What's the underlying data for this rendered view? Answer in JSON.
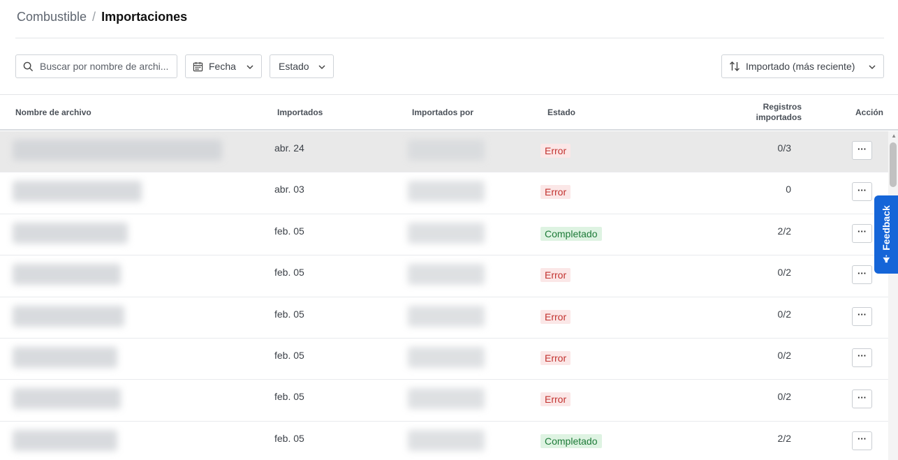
{
  "breadcrumb": {
    "parent": "Combustible",
    "separator": "/",
    "current": "Importaciones"
  },
  "toolbar": {
    "search_placeholder": "Buscar por nombre de archi...",
    "date_filter_label": "Fecha",
    "status_filter_label": "Estado",
    "sort_label": "Importado (más reciente)"
  },
  "table": {
    "headers": {
      "name": "Nombre de archivo",
      "imported": "Importados",
      "imported_by": "Importados por",
      "status": "Estado",
      "records_line1": "Registros",
      "records_line2": "importados",
      "action": "Acción"
    },
    "action_label": "···",
    "rows": [
      {
        "date": "abr. 24",
        "status": "Error",
        "records": "0/3",
        "status_kind": "error",
        "selected": true
      },
      {
        "date": "abr. 03",
        "status": "Error",
        "records": "0",
        "status_kind": "error"
      },
      {
        "date": "feb. 05",
        "status": "Completado",
        "records": "2/2",
        "status_kind": "done"
      },
      {
        "date": "feb. 05",
        "status": "Error",
        "records": "0/2",
        "status_kind": "error"
      },
      {
        "date": "feb. 05",
        "status": "Error",
        "records": "0/2",
        "status_kind": "error"
      },
      {
        "date": "feb. 05",
        "status": "Error",
        "records": "0/2",
        "status_kind": "error"
      },
      {
        "date": "feb. 05",
        "status": "Error",
        "records": "0/2",
        "status_kind": "error"
      },
      {
        "date": "feb. 05",
        "status": "Completado",
        "records": "2/2",
        "status_kind": "done"
      }
    ]
  },
  "feedback_tab": {
    "label": "Feedback",
    "icon": "megaphone-icon"
  },
  "colors": {
    "accent": "#1565d8",
    "error_bg": "#fbe7e7",
    "error_text": "#c2322f",
    "done_bg": "#def3e2",
    "done_text": "#1c7a37"
  }
}
